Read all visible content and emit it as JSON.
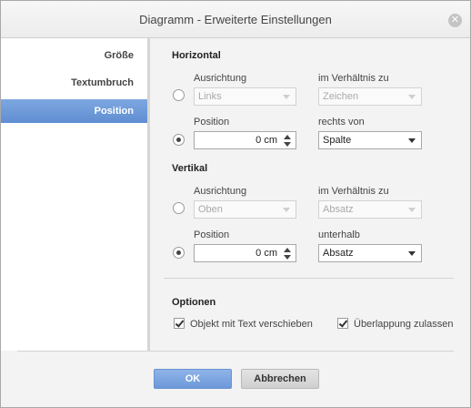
{
  "dialog": {
    "title": "Diagramm - Erweiterte Einstellungen",
    "close_glyph": "✕"
  },
  "sidebar": {
    "items": [
      {
        "label": "Größe",
        "active": false
      },
      {
        "label": "Textumbruch",
        "active": false
      },
      {
        "label": "Position",
        "active": true
      }
    ]
  },
  "horizontal": {
    "title": "Horizontal",
    "alignment_label": "Ausrichtung",
    "alignment_value": "Links",
    "relative_label": "im Verhältnis zu",
    "relative_value": "Zeichen",
    "position_label": "Position",
    "position_value": "0 cm",
    "right_of_label": "rechts von",
    "right_of_value": "Spalte",
    "alignment_selected": false,
    "position_selected": true
  },
  "vertical": {
    "title": "Vertikal",
    "alignment_label": "Ausrichtung",
    "alignment_value": "Oben",
    "relative_label": "im Verhältnis zu",
    "relative_value": "Absatz",
    "position_label": "Position",
    "position_value": "0 cm",
    "below_label": "unterhalb",
    "below_value": "Absatz",
    "alignment_selected": false,
    "position_selected": true
  },
  "options": {
    "title": "Optionen",
    "move_with_text_label": "Objekt mit Text verschieben",
    "move_with_text_checked": true,
    "allow_overlap_label": "Überlappung zulassen",
    "allow_overlap_checked": true
  },
  "footer": {
    "ok_label": "OK",
    "cancel_label": "Abbrechen"
  },
  "colors": {
    "accent": "#6c98da",
    "active_sidebar": "#5f8ed2"
  }
}
